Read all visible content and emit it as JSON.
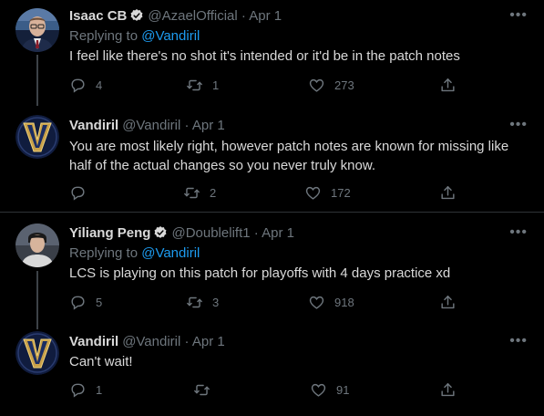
{
  "tweets": [
    {
      "name": "Isaac CB",
      "handle": "@AzaelOfficial",
      "separator": "·",
      "date": "Apr 1",
      "replying_label": "Replying to",
      "replying_to": "@Vandiril",
      "text": "I feel like there's no shot it's intended or it'd be in the patch notes",
      "replies": "4",
      "retweets": "1",
      "likes": "273"
    },
    {
      "name": "Vandiril",
      "handle": "@Vandiril",
      "separator": "·",
      "date": "Apr 1",
      "text": "You are most likely right, however patch notes are known for missing like half of the actual changes so you never truly know.",
      "replies": "",
      "retweets": "2",
      "likes": "172"
    },
    {
      "name": "Yiliang Peng",
      "handle": "@Doublelift1",
      "separator": "·",
      "date": "Apr 1",
      "replying_label": "Replying to",
      "replying_to": "@Vandiril",
      "text": "LCS is playing on this patch for playoffs with 4 days practice xd",
      "replies": "5",
      "retweets": "3",
      "likes": "918"
    },
    {
      "name": "Vandiril",
      "handle": "@Vandiril",
      "separator": "·",
      "date": "Apr 1",
      "text": "Can't wait!",
      "replies": "1",
      "retweets": "",
      "likes": "91"
    }
  ],
  "colors": {
    "background": "#000000",
    "text": "#d9d9d9",
    "muted": "#6e767d",
    "link": "#1d9bf0",
    "divider": "#2f3336"
  },
  "icons": [
    "verified-badge-icon",
    "more-options-icon",
    "reply-icon",
    "retweet-icon",
    "like-icon",
    "share-icon"
  ]
}
